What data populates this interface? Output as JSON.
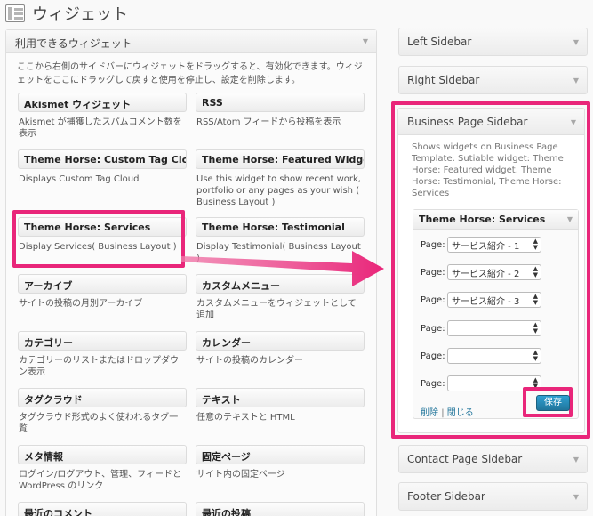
{
  "page": {
    "title": "ウィジェット",
    "icon": "widgets-icon"
  },
  "available": {
    "title": "利用できるウィジェット",
    "description": "ここから右側のサイドバーにウィジェットをドラッグすると、有効化できます。ウィジェットをここにドラッグして戻すと使用を停止し、設定を削除します。",
    "widgets": [
      {
        "name": "Akismet ウィジェット",
        "desc": "Akismet が捕獲したスパムコメント数を表示"
      },
      {
        "name": "RSS",
        "desc": "RSS/Atom フィードから投稿を表示"
      },
      {
        "name": "Theme Horse: Custom Tag Cloud",
        "desc": "Displays Custom Tag Cloud"
      },
      {
        "name": "Theme Horse: Featured Widget",
        "desc": "Use this widget to show recent work, portfolio or any pages as your wish ( Business Layout )"
      },
      {
        "name": "Theme Horse: Services",
        "desc": "Display Services( Business Layout )"
      },
      {
        "name": "Theme Horse: Testimonial",
        "desc": "Display Testimonial( Business Layout )"
      },
      {
        "name": "アーカイブ",
        "desc": "サイトの投稿の月別アーカイブ"
      },
      {
        "name": "カスタムメニュー",
        "desc": "カスタムメニューをウィジェットとして追加"
      },
      {
        "name": "カテゴリー",
        "desc": "カテゴリーのリストまたはドロップダウン表示"
      },
      {
        "name": "カレンダー",
        "desc": "サイトの投稿のカレンダー"
      },
      {
        "name": "タグクラウド",
        "desc": "タグクラウド形式のよく使われるタグ一覧"
      },
      {
        "name": "テキスト",
        "desc": "任意のテキストと HTML"
      },
      {
        "name": "メタ情報",
        "desc": "ログイン/ログアウト、管理、フィードと WordPress のリンク"
      },
      {
        "name": "固定ページ",
        "desc": "サイト内の固定ページ"
      },
      {
        "name": "最近のコメント",
        "desc": ""
      },
      {
        "name": "最近の投稿",
        "desc": ""
      }
    ]
  },
  "sidebars": {
    "left": "Left Sidebar",
    "right": "Right Sidebar",
    "business": {
      "title": "Business Page Sidebar",
      "description": "Shows widgets on Business Page Template. Sutiable widget: Theme Horse: Featured widget, Theme Horse: Testimonial, Theme Horse: Services"
    },
    "contact": "Contact Page Sidebar",
    "footer": "Footer Sidebar"
  },
  "services_widget": {
    "title": "Theme Horse: Services",
    "page_label": "Page:",
    "selects": [
      "サービス紹介 - 1",
      "サービス紹介 - 2",
      "サービス紹介 - 3",
      "",
      "",
      ""
    ],
    "delete_link": "削除",
    "separator": "|",
    "close_link": "閉じる",
    "save_button": "保存"
  },
  "colors": {
    "highlight": "#e9267a",
    "link": "#21759b",
    "button": "#21759b"
  }
}
